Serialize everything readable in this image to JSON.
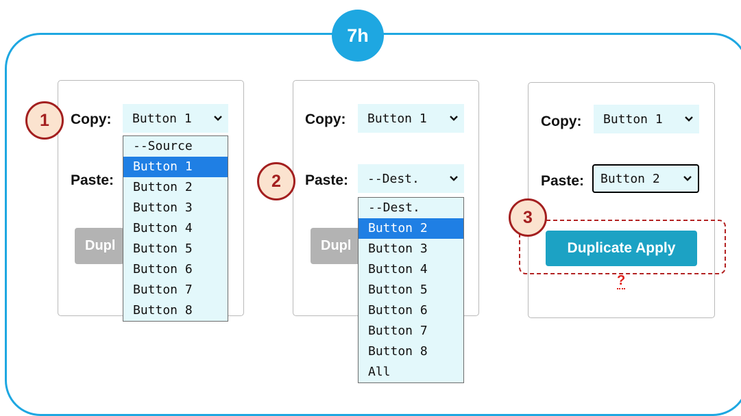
{
  "step_label": "7h",
  "callouts": [
    "1",
    "2",
    "3"
  ],
  "copy_label": "Copy:",
  "paste_label": "Paste:",
  "panel1": {
    "copy_value": "Button 1",
    "button_partial": "Dupl",
    "source_options": [
      "--Source",
      "Button 1",
      "Button 2",
      "Button 3",
      "Button 4",
      "Button 5",
      "Button 6",
      "Button 7",
      "Button 8"
    ],
    "selected_option": "Button 1"
  },
  "panel2": {
    "copy_value": "Button 1",
    "paste_value": "--Dest.",
    "button_partial": "Dupl",
    "dest_options": [
      "--Dest.",
      "Button 2",
      "Button 3",
      "Button 4",
      "Button 5",
      "Button 6",
      "Button 7",
      "Button 8",
      "All"
    ],
    "selected_option": "Button 2"
  },
  "panel3": {
    "copy_value": "Button 1",
    "paste_value": "Button 2",
    "apply_label": "Duplicate Apply",
    "help_mark": "?"
  },
  "colors": {
    "frame": "#1ea7e1",
    "select_bg": "#e3f8fb",
    "apply_button": "#1ca2c4",
    "highlight": "#1f7fe4",
    "callout_border": "#a31f1f",
    "callout_fill": "#fbe3cf"
  }
}
